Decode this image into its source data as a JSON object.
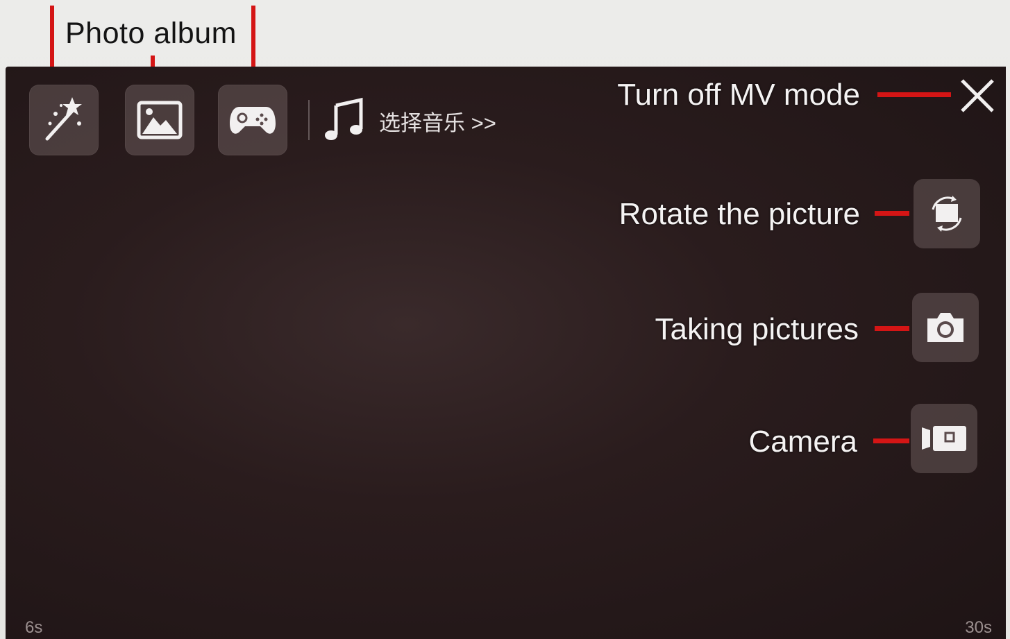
{
  "caption": {
    "photo_album": "Photo album"
  },
  "toolbar": {
    "effects_icon": "magic-wand-icon",
    "album_icon": "picture-icon",
    "game_icon": "gamepad-icon",
    "music_icon": "music-note-icon",
    "music_label": "选择音乐 >>"
  },
  "annotations": {
    "close_mv": "Turn off MV mode",
    "rotate": "Rotate the picture",
    "take_pictures": "Taking pictures",
    "camera": "Camera"
  },
  "side_buttons": {
    "rotate_icon": "rotate-icon",
    "photo_icon": "camera-icon",
    "video_icon": "video-camera-icon",
    "close_icon": "close-icon"
  },
  "timeline": {
    "start": "6s",
    "end": "30s"
  },
  "colors": {
    "annotation_line": "#d41515",
    "screen_bg": "#2a1c1d",
    "button_bg": "#786868"
  }
}
